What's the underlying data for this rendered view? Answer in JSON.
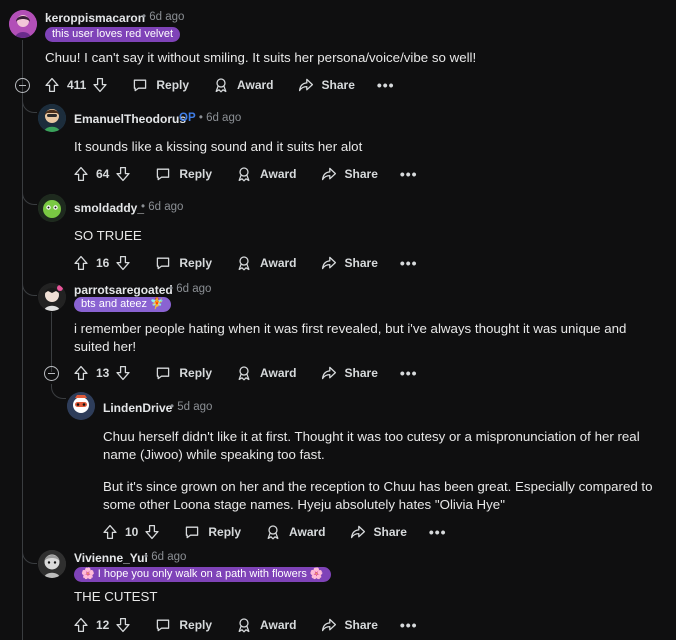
{
  "comments": [
    {
      "username": "keroppismacaron",
      "time": "6d ago",
      "flair": "this user loves red velvet",
      "body": [
        "Chuu! I can't say it without smiling. It suits her persona/voice/vibe so well!"
      ],
      "score": "411",
      "avatar_color": "#b24fb7"
    },
    {
      "username": "EmanuelTheodorus",
      "op_badge": "OP",
      "time": "6d ago",
      "body": [
        "It sounds like a kissing sound and it suits her alot"
      ],
      "score": "64"
    },
    {
      "username": "smoldaddy_",
      "time": "6d ago",
      "body": [
        "SO TRUEE"
      ],
      "score": "16"
    },
    {
      "username": "parrotsaregoated",
      "time": "6d ago",
      "flair": "bts and ateez 🧚",
      "body": [
        "i remember people hating when it was first revealed, but i've always thought it was unique and suited her!"
      ],
      "score": "13"
    },
    {
      "username": "LindenDrive",
      "time": "5d ago",
      "body": [
        "Chuu herself didn't like it at first. Thought it was too cutesy or a mispronunciation of her real name (Jiwoo) while speaking too fast.",
        "But it's since grown on her and the reception to Chuu has been great. Especially compared to some other Loona stage names. Hyeju absolutely hates \"Olivia Hye\""
      ],
      "score": "10"
    },
    {
      "username": "Vivienne_Yui",
      "time": "6d ago",
      "flair": "🌸 I hope you only walk on a path with flowers 🌸",
      "body": [
        "THE CUTEST"
      ],
      "score": "12"
    }
  ],
  "actions": {
    "reply": "Reply",
    "award": "Award",
    "share": "Share",
    "more": "•••"
  },
  "separator": "•",
  "colors": {
    "background": "#0f0f10",
    "flair_purple": "#7f43b8",
    "flair_lavender": "#8a63d2",
    "op_blue": "#3f7de6",
    "thread_line": "#3a3d40"
  },
  "icons": [
    "upvote-icon",
    "downvote-icon",
    "reply-icon",
    "award-icon",
    "share-icon",
    "collapse-icon"
  ]
}
